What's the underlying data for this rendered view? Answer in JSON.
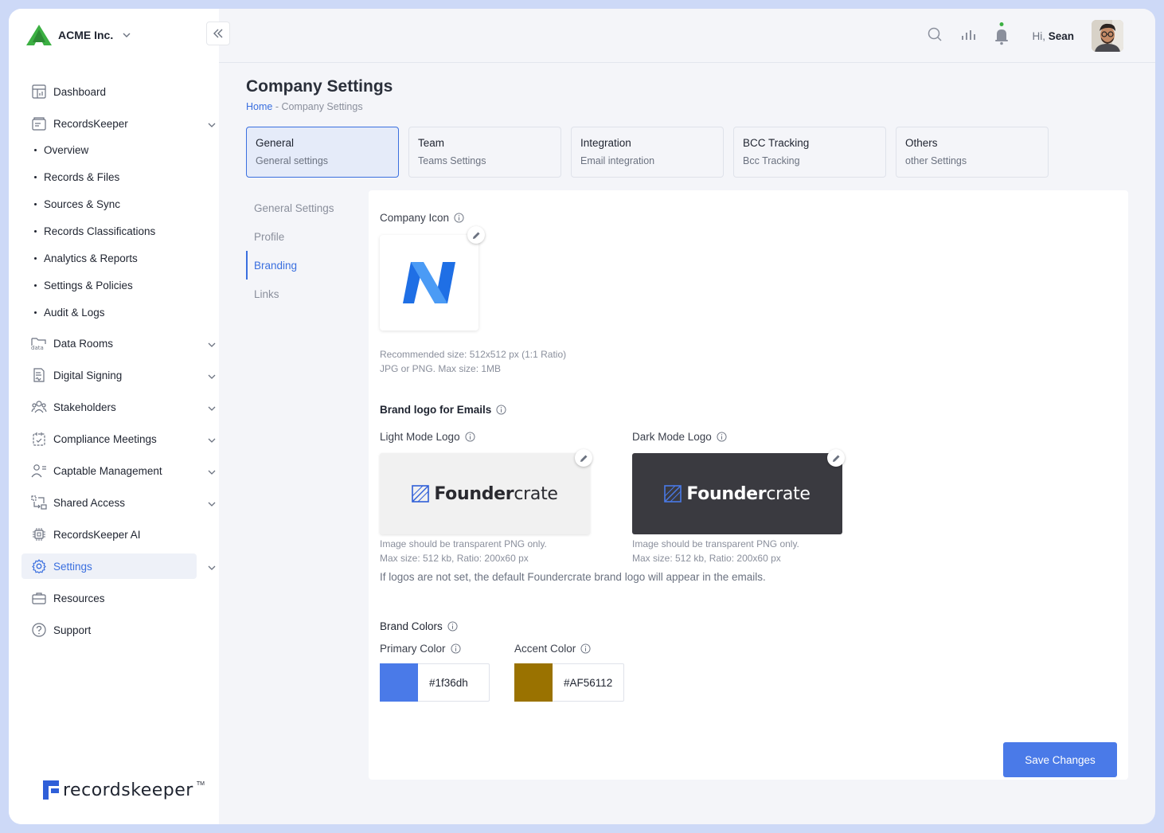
{
  "org": {
    "name": "ACME Inc."
  },
  "sidebar": {
    "items": [
      {
        "label": "Dashboard"
      },
      {
        "label": "RecordsKeeper"
      },
      {
        "label": "Data Rooms"
      },
      {
        "label": "Digital Signing"
      },
      {
        "label": "Stakeholders"
      },
      {
        "label": "Compliance Meetings"
      },
      {
        "label": "Captable Management"
      },
      {
        "label": "Shared Access"
      },
      {
        "label": "RecordsKeeper AI"
      },
      {
        "label": "Settings"
      },
      {
        "label": "Resources"
      },
      {
        "label": "Support"
      }
    ],
    "subitems": [
      {
        "label": "Overview"
      },
      {
        "label": "Records & Files"
      },
      {
        "label": "Sources & Sync"
      },
      {
        "label": "Records Classifications"
      },
      {
        "label": "Analytics & Reports"
      },
      {
        "label": "Settings & Policies"
      },
      {
        "label": "Audit & Logs"
      }
    ],
    "brand": "recordskeeper",
    "brand_tm": "TM"
  },
  "header": {
    "greeting": "Hi,",
    "user": "Sean"
  },
  "page": {
    "title": "Company Settings",
    "breadcrumb_home": "Home",
    "breadcrumb_sep": " - ",
    "breadcrumb_current": "Company Settings"
  },
  "tabs": [
    {
      "title": "General",
      "sub": "General settings"
    },
    {
      "title": "Team",
      "sub": "Teams Settings"
    },
    {
      "title": "Integration",
      "sub": "Email integration"
    },
    {
      "title": "BCC Tracking",
      "sub": "Bcc Tracking"
    },
    {
      "title": "Others",
      "sub": "other Settings"
    }
  ],
  "subnav": [
    {
      "label": "General Settings"
    },
    {
      "label": "Profile"
    },
    {
      "label": "Branding"
    },
    {
      "label": "Links"
    }
  ],
  "branding": {
    "company_icon_label": "Company Icon",
    "icon_hint_1": "Recommended size: 512x512 px (1:1 Ratio)",
    "icon_hint_2": "JPG or PNG. Max size: 1MB",
    "brand_logo_label": "Brand logo for Emails",
    "light_label": "Light Mode Logo",
    "dark_label": "Dark Mode Logo",
    "logo_hint_1": "Image should be transparent PNG only.",
    "logo_hint_2": "Max size: 512 kb, Ratio: 200x60 px",
    "logo_word_bold": "Founder",
    "logo_word_light": "crate",
    "note": "If logos are not set, the default Foundercrate brand logo will appear in the emails.",
    "colors_label": "Brand Colors",
    "primary_label": "Primary Color",
    "primary_hex": "#1f36dh",
    "primary_swatch": "#4a7ae8",
    "accent_label": "Accent Color",
    "accent_hex": "#AF56112",
    "accent_swatch": "#9a7200",
    "save_label": "Save Changes"
  }
}
